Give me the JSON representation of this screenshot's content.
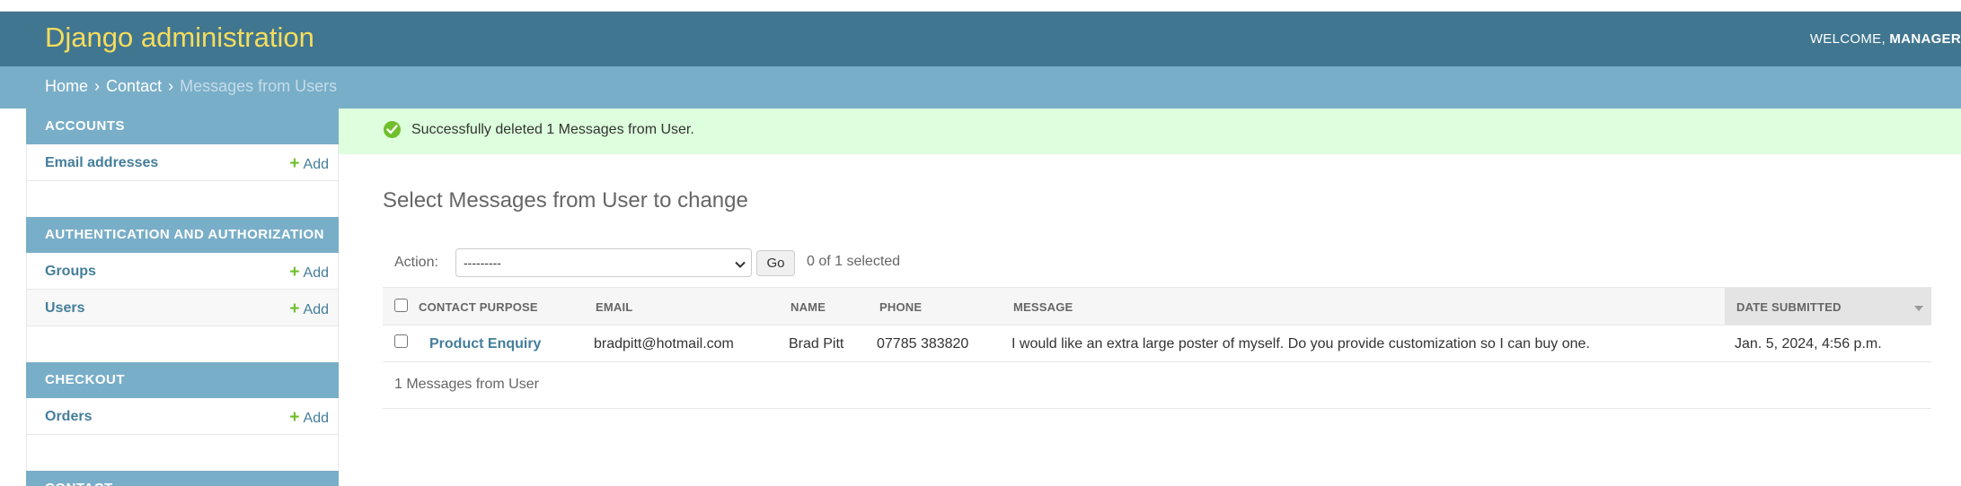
{
  "header": {
    "brand": "Django administration",
    "welcome": "WELCOME,",
    "username": "MANAGER"
  },
  "breadcrumbs": {
    "home": "Home",
    "app": "Contact",
    "current": "Messages from Users",
    "separator": "›"
  },
  "sidebar": {
    "add_label": "Add",
    "modules": [
      {
        "caption": "Accounts",
        "models": [
          "Email addresses"
        ]
      },
      {
        "caption": "Authentication and Authorization",
        "models": [
          "Groups",
          "Users"
        ]
      },
      {
        "caption": "Checkout",
        "models": [
          "Orders"
        ]
      },
      {
        "caption": "Contact",
        "models": []
      }
    ]
  },
  "message": {
    "text": "Successfully deleted 1 Messages from User.",
    "status_color": "#70bf2b"
  },
  "content": {
    "title": "Select Messages from User to change"
  },
  "actions": {
    "label": "Action:",
    "selected_value": "---------",
    "go_label": "Go",
    "counter": "0 of 1 selected"
  },
  "table": {
    "columns": [
      "Contact purpose",
      "Email",
      "Name",
      "Phone",
      "Message",
      "Date submitted"
    ],
    "rows": [
      {
        "contact_purpose": "Product Enquiry",
        "email": "bradpitt@hotmail.com",
        "name": "Brad Pitt",
        "phone": "07785 383820",
        "message": "I would like an extra large poster of myself. Do you provide customization so I can buy one.",
        "date_submitted": "Jan. 5, 2024, 4:56 p.m."
      }
    ],
    "paginator": "1 Messages from User"
  },
  "colors": {
    "header_bg": "#417690",
    "brand": "#f5dd5d",
    "breadcrumbs_bg": "#79aec8",
    "link": "#447e9b",
    "success_bg": "#ddffdd"
  }
}
